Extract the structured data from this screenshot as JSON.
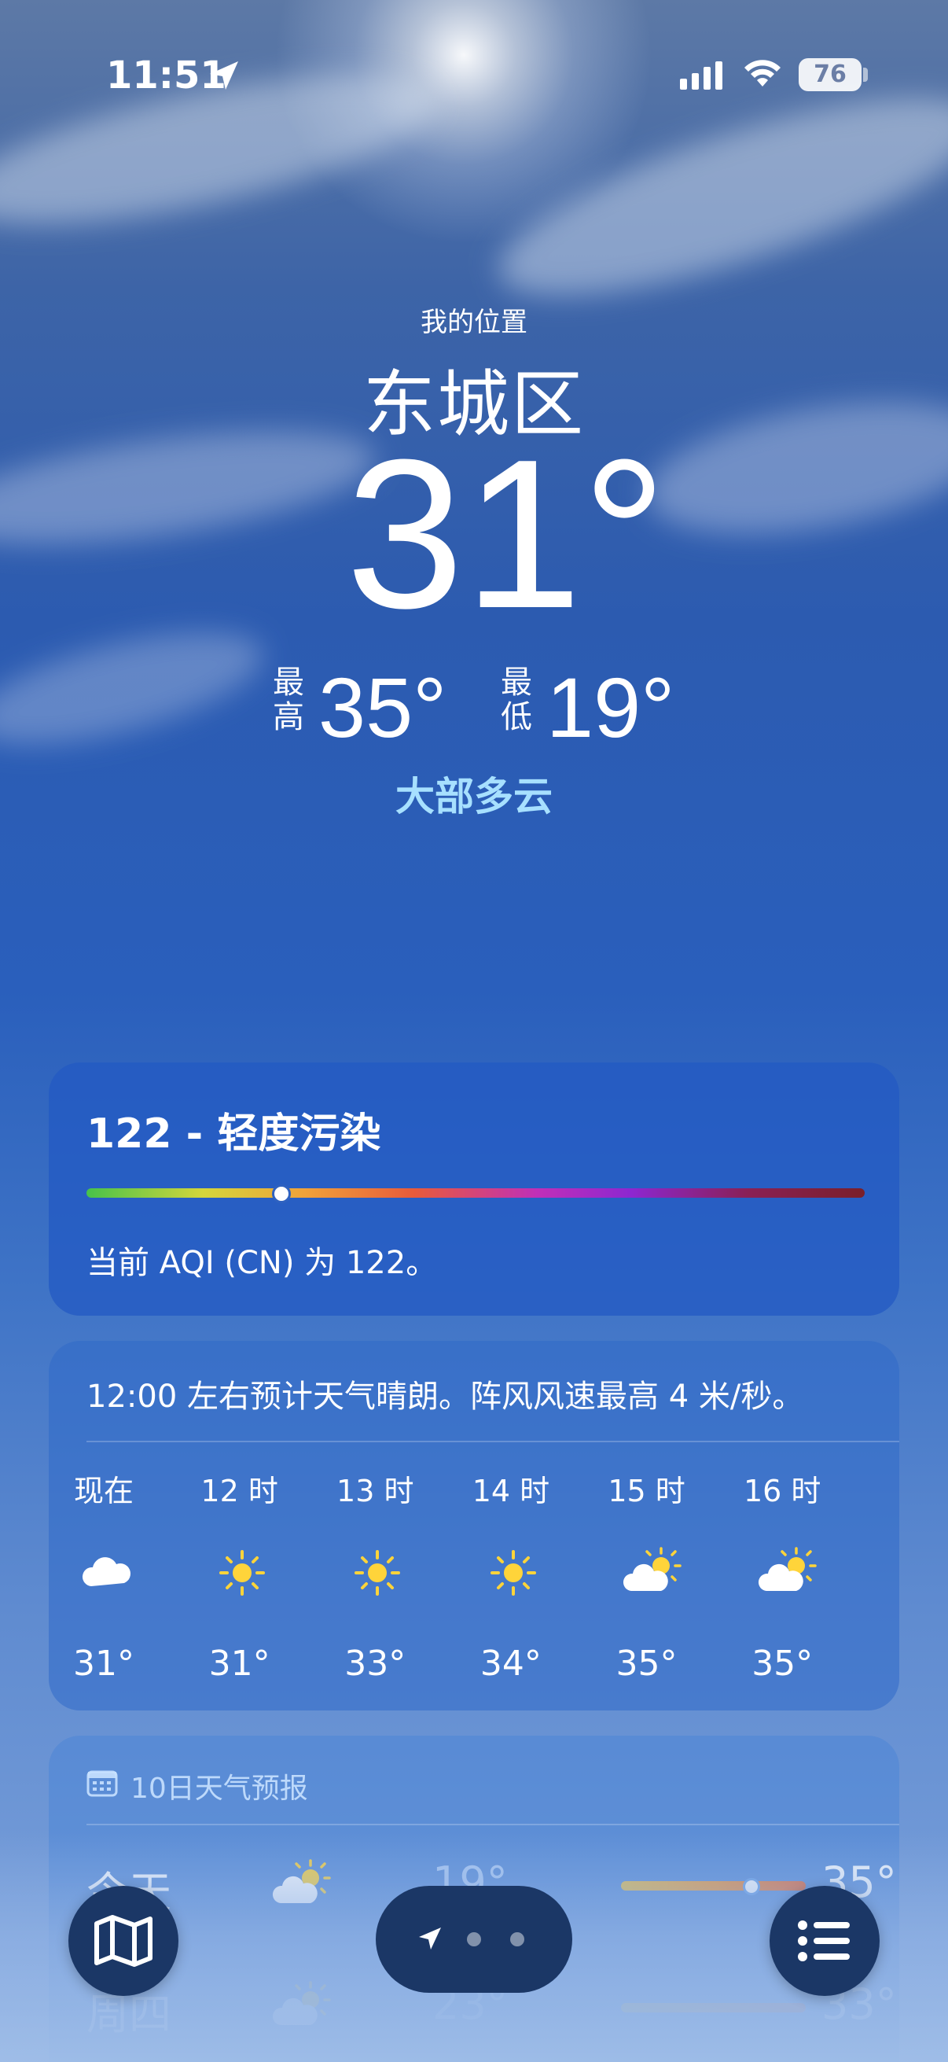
{
  "status": {
    "time": "11:51",
    "battery": "76"
  },
  "location": {
    "label": "我的位置",
    "city": "东城区"
  },
  "current": {
    "temp": "31°",
    "high_label": "最高",
    "high": "35°",
    "low_label": "最低",
    "low": "19°",
    "condition": "大部多云"
  },
  "aqi": {
    "title": "122 - 轻度污染",
    "value_fraction": 0.25,
    "description": "当前 AQI (CN) 为 122。"
  },
  "hourly": {
    "summary": "12:00 左右预计天气晴朗。阵风风速最高 4 米/秒。",
    "items": [
      {
        "label": "现在",
        "icon": "cloud-icon",
        "temp": "31°"
      },
      {
        "label": "12 时",
        "icon": "sun-icon",
        "temp": "31°"
      },
      {
        "label": "13 时",
        "icon": "sun-icon",
        "temp": "33°"
      },
      {
        "label": "14 时",
        "icon": "sun-icon",
        "temp": "34°"
      },
      {
        "label": "15 时",
        "icon": "partly-cloudy-icon",
        "temp": "35°"
      },
      {
        "label": "16 时",
        "icon": "partly-cloudy-icon",
        "temp": "35°"
      }
    ]
  },
  "daily": {
    "header": "10日天气预报",
    "items": [
      {
        "day": "今天",
        "icon": "partly-cloudy-icon",
        "low": "19°",
        "high": "35°"
      },
      {
        "day": "周四",
        "icon": "partly-cloudy-icon",
        "low": "23°",
        "high": "33°"
      }
    ]
  },
  "colors": {
    "condition": "#a7e0ff",
    "fab": "#1b3766"
  },
  "bottom_bar": {
    "map_icon": "map-icon",
    "location_icon": "location-arrow-icon",
    "list_icon": "list-icon"
  }
}
